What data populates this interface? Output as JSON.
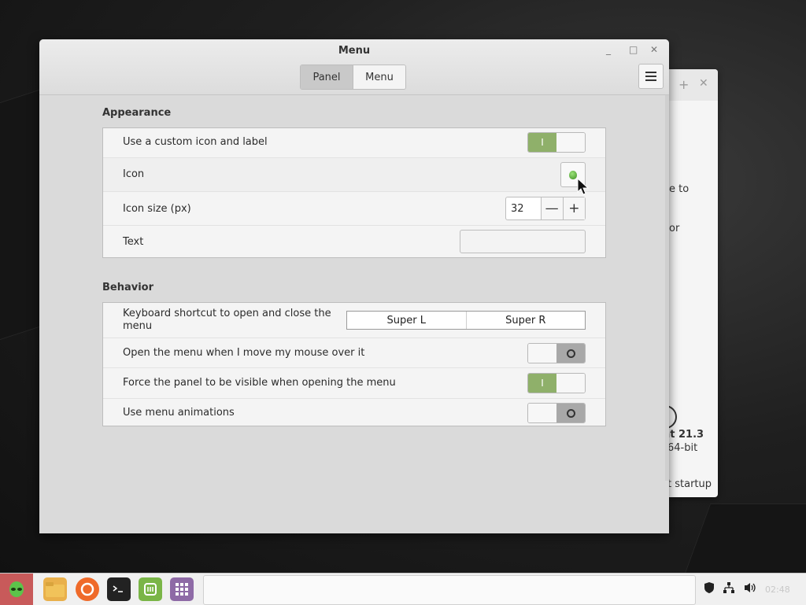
{
  "window": {
    "title": "Menu",
    "controls": {
      "minimize": "_",
      "maximize": "□",
      "close": "✕"
    }
  },
  "tabs": [
    {
      "label": "Panel",
      "active": true
    },
    {
      "label": "Menu",
      "active": false
    }
  ],
  "appearance": {
    "section_title": "Appearance",
    "custom_icon_label": "Use a custom icon and label",
    "custom_icon_on": true,
    "icon_label": "Icon",
    "icon_size_label": "Icon size (px)",
    "icon_size_value": "32",
    "text_label": "Text",
    "text_value": ""
  },
  "behavior": {
    "section_title": "Behavior",
    "shortcut_label": "Keyboard shortcut to open and close the menu",
    "shortcut_key_1": "Super L",
    "shortcut_key_2": "Super R",
    "hover_open_label": "Open the menu when I move my mouse over it",
    "hover_open_on": false,
    "force_visible_label": "Force the panel to be visible when opening the menu",
    "force_visible_on": true,
    "animations_label": "Use menu animations",
    "animations_on": false
  },
  "switch_glyphs": {
    "on": "I",
    "off": "O"
  },
  "spin_glyphs": {
    "minus": "—",
    "plus": "+"
  },
  "back_window": {
    "text_1": "e to",
    "text_2": "or",
    "text_3": "nt 21.3",
    "text_4": "64-bit",
    "text_5": "t startup"
  },
  "taskbar": {
    "clock": "02:48"
  },
  "colors": {
    "accent_green": "#8fb06a",
    "menu_button": "#c85a5a"
  }
}
